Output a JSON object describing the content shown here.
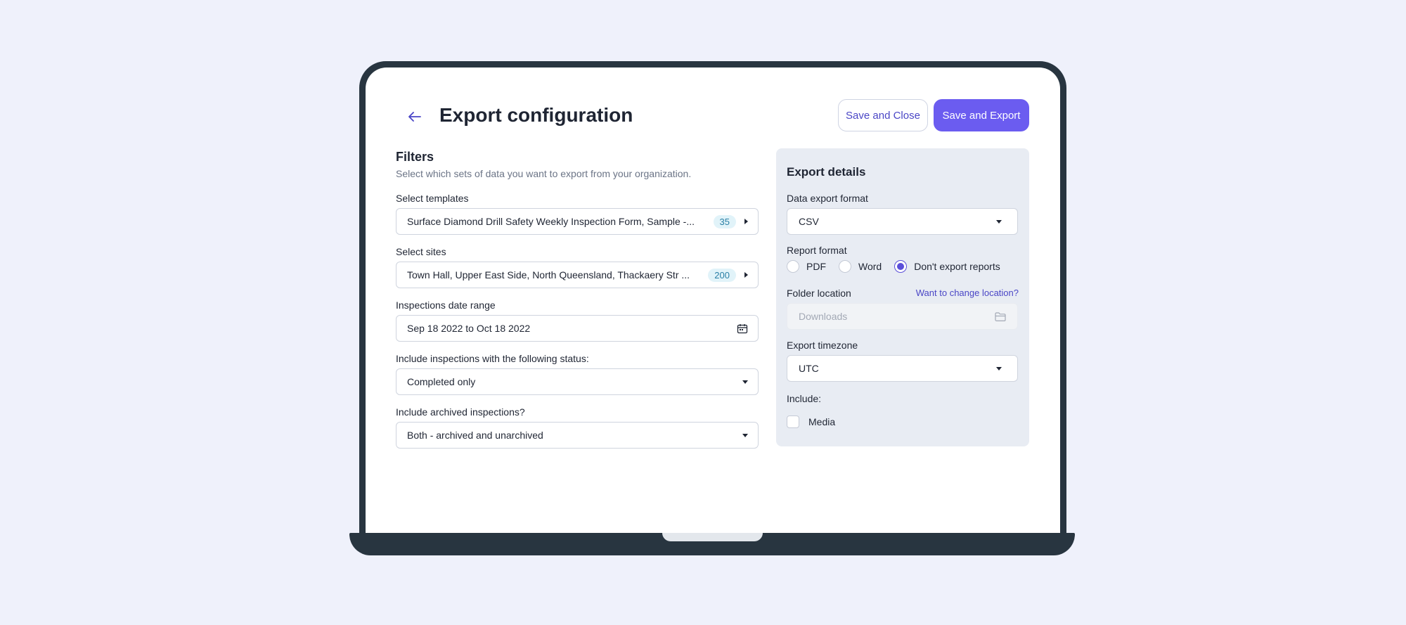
{
  "header": {
    "title": "Export configuration",
    "back_icon": "arrow-left-icon",
    "save_close_label": "Save and Close",
    "save_export_label": "Save and Export"
  },
  "filters": {
    "title": "Filters",
    "description": "Select which sets of data you want to export from your organization.",
    "templates": {
      "label": "Select templates",
      "value": "Surface Diamond Drill Safety Weekly Inspection Form, Sample -...",
      "count": "35"
    },
    "sites": {
      "label": "Select sites",
      "value": "Town Hall, Upper East Side, North Queensland, Thackaery Str ...",
      "count": "200"
    },
    "date_range": {
      "label": "Inspections date range",
      "value": "Sep 18 2022 to Oct 18 2022"
    },
    "status": {
      "label": "Include inspections with the following status:",
      "value": "Completed only"
    },
    "archived": {
      "label": "Include archived inspections?",
      "value": "Both - archived and unarchived"
    }
  },
  "export_details": {
    "title": "Export details",
    "format": {
      "label": "Data export format",
      "value": "CSV"
    },
    "report_format": {
      "label": "Report format",
      "options": [
        "PDF",
        "Word",
        "Don't export reports"
      ],
      "selected": "Don't export reports"
    },
    "folder": {
      "label": "Folder location",
      "change_link": "Want to change location?",
      "placeholder": "Downloads"
    },
    "timezone": {
      "label": "Export timezone",
      "value": "UTC"
    },
    "include": {
      "label": "Include:",
      "media_label": "Media",
      "media_checked": false
    }
  },
  "colors": {
    "background": "#eff1fb",
    "primary": "#6b5cf0",
    "accent_text": "#4a46c6",
    "panel": "#e8ecf3",
    "frame": "#283540"
  }
}
